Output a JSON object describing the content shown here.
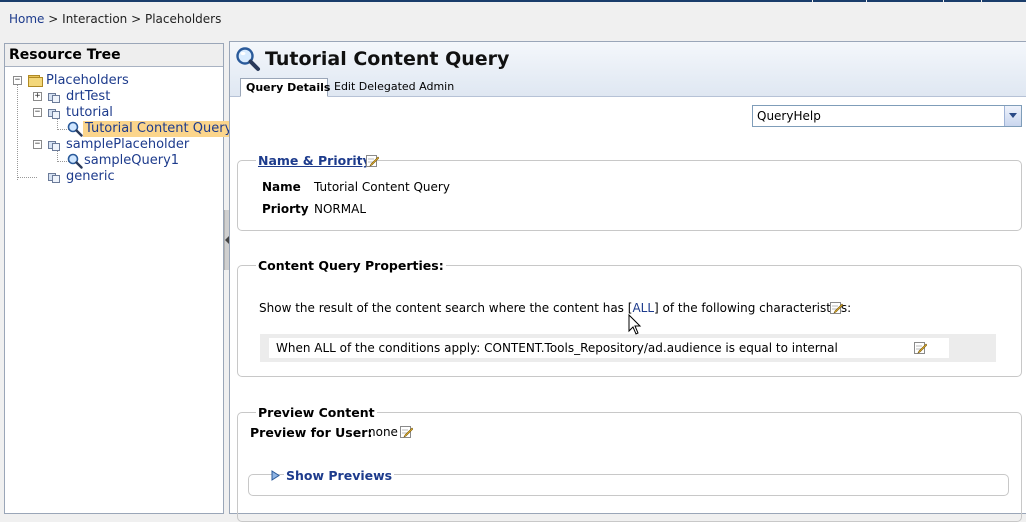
{
  "breadcrumb": {
    "home": "Home",
    "interaction": "Interaction",
    "placeholders": "Placeholders",
    "separator": ">"
  },
  "tree": {
    "header": "Resource Tree",
    "items": [
      {
        "label": "Placeholders",
        "icon": "folder-icon",
        "expander": "−"
      },
      {
        "label": "drtTest",
        "icon": "placeholder-icon",
        "expander": "+"
      },
      {
        "label": "tutorial",
        "icon": "placeholder-icon",
        "expander": "−"
      },
      {
        "label": "Tutorial Content Query",
        "icon": "query-icon",
        "selected": true
      },
      {
        "label": "samplePlaceholder",
        "icon": "placeholder-icon",
        "expander": "−"
      },
      {
        "label": "sampleQuery1",
        "icon": "query-icon"
      },
      {
        "label": "generic",
        "icon": "placeholder-icon"
      }
    ]
  },
  "main": {
    "title": "Tutorial Content Query",
    "tabs": [
      {
        "label": "Query Details",
        "active": true
      },
      {
        "label": "Edit Delegated Admin",
        "active": false
      }
    ],
    "help_select": {
      "value": "QueryHelp"
    },
    "name_priority": {
      "legend": "Name & Priority",
      "name_label": "Name",
      "name_value": "Tutorial Content Query",
      "priority_label": "Priorty",
      "priority_value": "NORMAL"
    },
    "content_query": {
      "legend": "Content Query Properties:",
      "sentence_pre": "Show the result of the content search where the content has [",
      "all": "ALL",
      "sentence_post": "] of the following characteristics:",
      "condition": "When ALL of the conditions apply: CONTENT.Tools_Repository/ad.audience is equal to internal"
    },
    "preview": {
      "legend": "Preview Content",
      "user_label": "Preview for User:",
      "user_value": "none",
      "show_previews": "Show Previews"
    }
  },
  "colors": {
    "link": "#1d3b8c",
    "selected": "#fbd58c",
    "header_bg": "#dfe7f2"
  }
}
